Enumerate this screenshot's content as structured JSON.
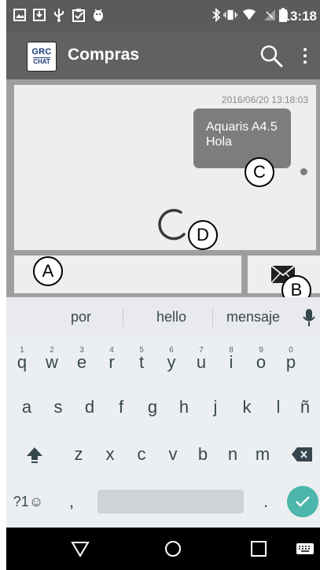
{
  "status_bar": {
    "time": "13:18",
    "icons_left": [
      "image-notification-icon",
      "download-icon",
      "usb-icon",
      "clipboard-icon",
      "android-debug-icon"
    ],
    "icons_right": [
      "bluetooth-icon",
      "vibrate-icon",
      "wifi-icon",
      "no-signal-icon",
      "battery-icon"
    ]
  },
  "app_bar": {
    "logo_text_top": "GRC",
    "logo_text_bottom": "CHAT",
    "title": "Compras",
    "actions": [
      "search-icon",
      "overflow-menu-icon"
    ]
  },
  "chat": {
    "date": "2016/06/20 13:18:03",
    "bubble_lines": [
      "Aquaris A4.5",
      "Hola"
    ],
    "loading": true
  },
  "annotations": {
    "a": "A",
    "b": "B",
    "c": "C",
    "d": "D"
  },
  "message_input": {
    "value": "",
    "placeholder": ""
  },
  "keyboard": {
    "suggestions": [
      "por",
      "hello",
      "mensaje"
    ],
    "row1": [
      {
        "key": "q",
        "hint": "1"
      },
      {
        "key": "w",
        "hint": "2"
      },
      {
        "key": "e",
        "hint": "3"
      },
      {
        "key": "r",
        "hint": "4"
      },
      {
        "key": "t",
        "hint": "5"
      },
      {
        "key": "y",
        "hint": "6"
      },
      {
        "key": "u",
        "hint": "7"
      },
      {
        "key": "i",
        "hint": "8"
      },
      {
        "key": "o",
        "hint": "9"
      },
      {
        "key": "p",
        "hint": "0"
      }
    ],
    "row2": [
      "a",
      "s",
      "d",
      "f",
      "g",
      "h",
      "j",
      "k",
      "l",
      "ñ"
    ],
    "row3": [
      "z",
      "x",
      "c",
      "v",
      "b",
      "n",
      "m"
    ],
    "symbols_key": "?1☺",
    "comma_key": ",",
    "period_key": "."
  },
  "colors": {
    "status_bar": "#5b5b5b",
    "app_bar": "#616161",
    "bubble": "#7d7d7d",
    "enter_key": "#4db6ac",
    "dim_overlay": "#9e9e9e"
  }
}
